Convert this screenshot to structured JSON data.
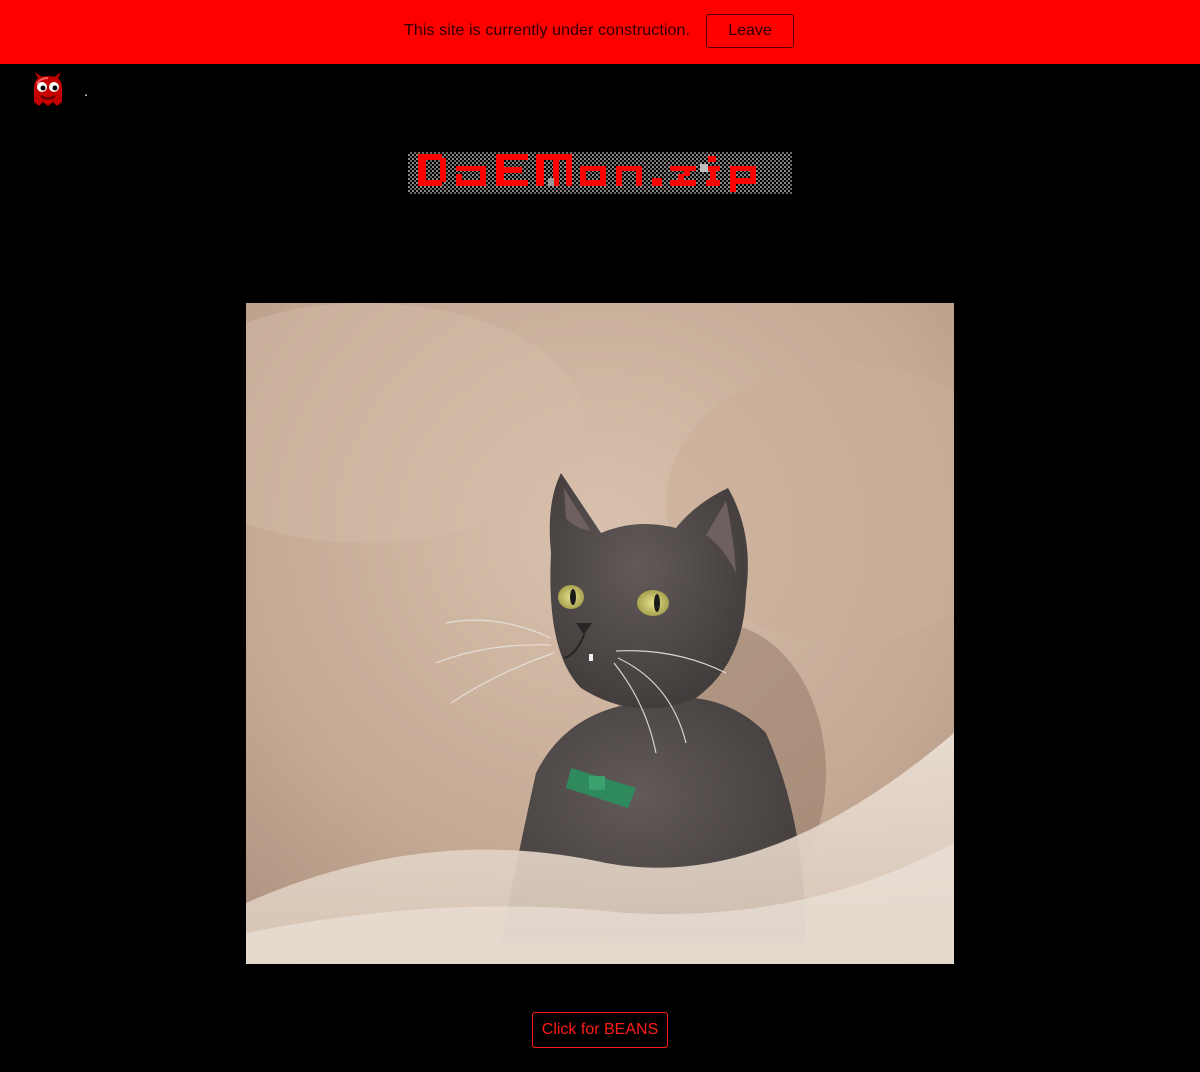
{
  "banner": {
    "message": "This site is currently under construction.",
    "leave_label": "Leave",
    "background": "#ff0000"
  },
  "nav": {
    "logo_icon": "daemon-mascot-icon",
    "home_link": "."
  },
  "header": {
    "site_title": "DAEMON.ZIP"
  },
  "main": {
    "photo_subject": "cat-photo",
    "beans_label": "Click for BEANS"
  },
  "colors": {
    "accent": "#ff1a1a",
    "background": "#000000"
  }
}
